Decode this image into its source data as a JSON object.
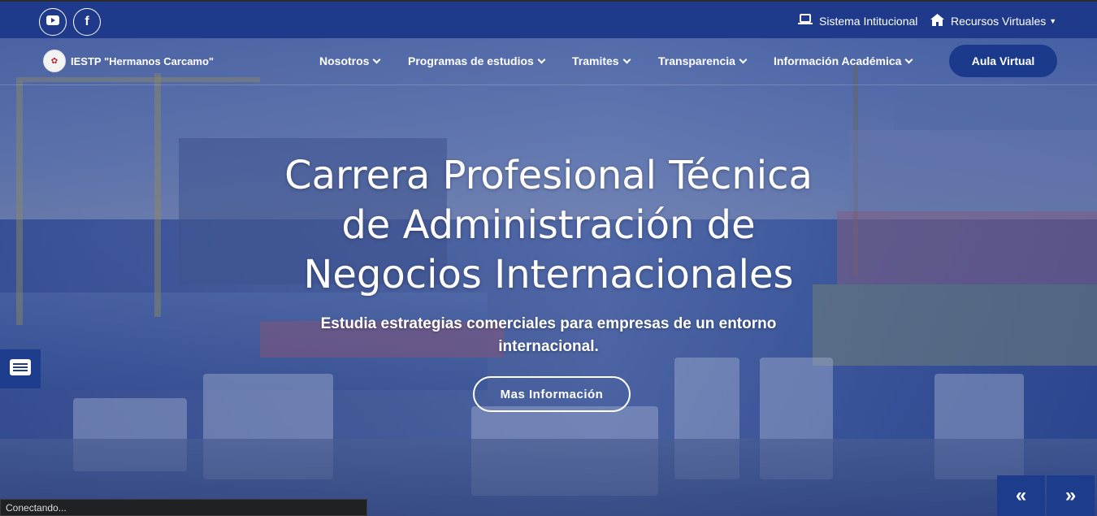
{
  "topbar": {
    "social": [
      {
        "icon": "youtube-icon",
        "glyph": "▶"
      },
      {
        "icon": "facebook-icon",
        "glyph": "f"
      }
    ],
    "sistema_label": "Sistema Intitucional",
    "recursos_label": "Recursos Virtuales"
  },
  "nav": {
    "logo_text": "IESTP \"Hermanos Carcamo\"",
    "items": [
      {
        "label": "Nosotros"
      },
      {
        "label": "Programas de estudios"
      },
      {
        "label": "Tramites"
      },
      {
        "label": "Transparencia"
      },
      {
        "label": "Información Académica"
      }
    ],
    "aula_label": "Aula Virtual"
  },
  "hero": {
    "title": "Carrera Profesional Técnica de Administración de Negocios Internacionales",
    "subtitle": "Estudia estrategias comerciales para empresas de un entorno internacional.",
    "button_label": "Mas Información"
  },
  "slider": {
    "prev_glyph": "«",
    "next_glyph": "»"
  },
  "status_text": "Conectando..."
}
